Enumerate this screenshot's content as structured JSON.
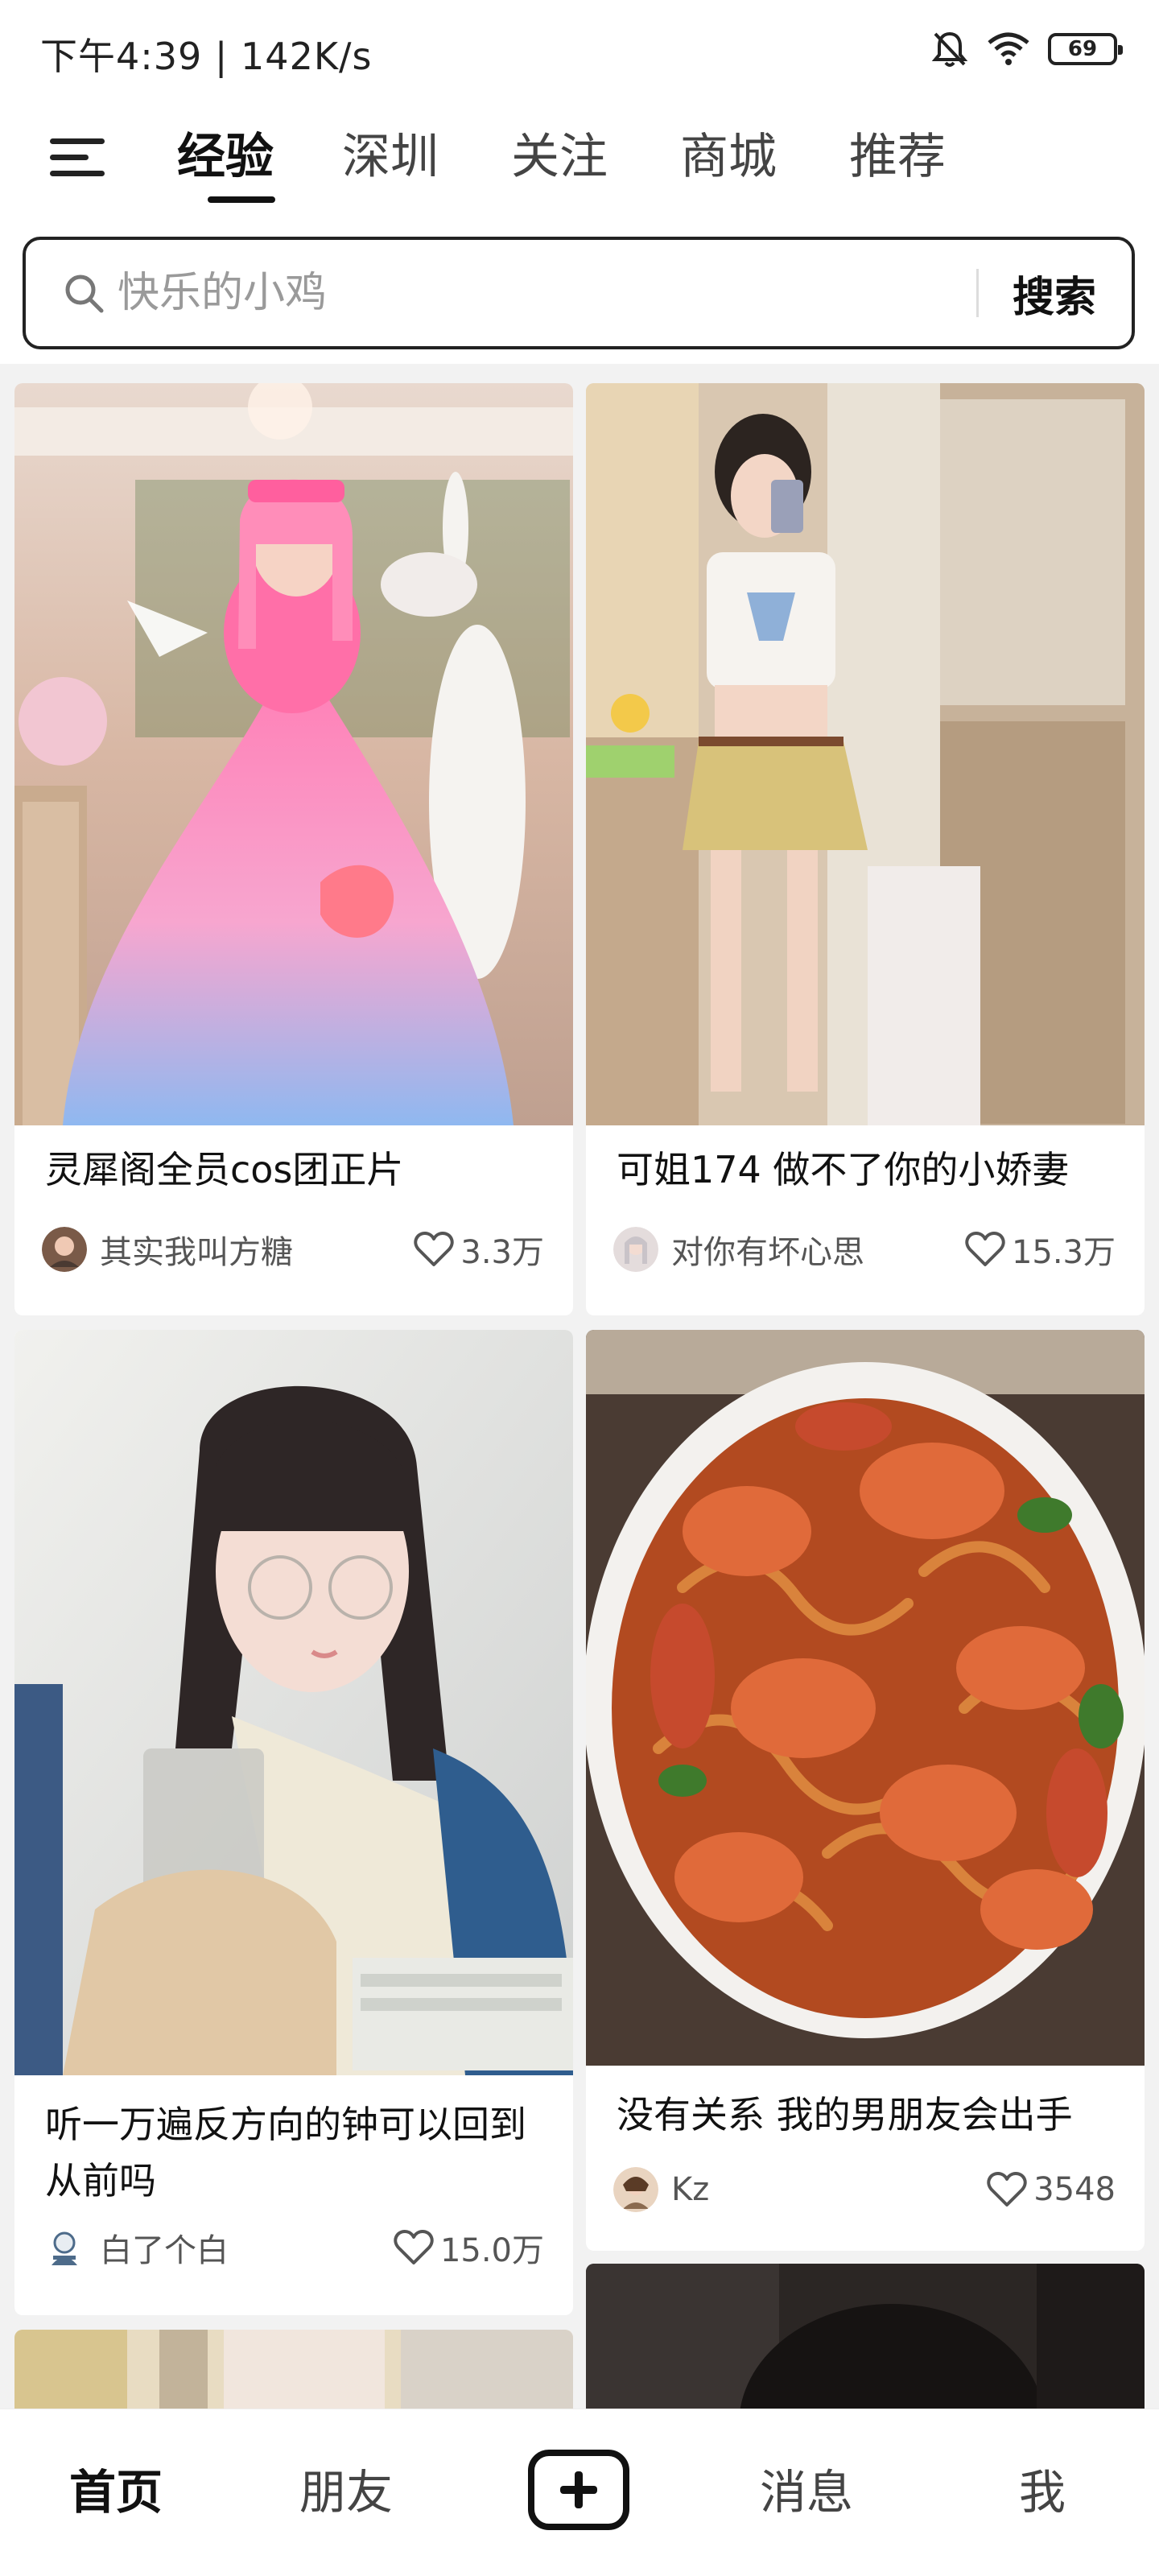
{
  "status_bar": {
    "time_speed": "下午4:39 | 142K/s",
    "battery": "69",
    "icons": [
      "bell-off-icon",
      "wifi-icon",
      "battery-icon"
    ]
  },
  "top_nav": {
    "menu_icon": "menu-icon",
    "tabs": [
      {
        "label": "经验",
        "active": true
      },
      {
        "label": "深圳",
        "active": false
      },
      {
        "label": "关注",
        "active": false
      },
      {
        "label": "商城",
        "active": false
      },
      {
        "label": "推荐",
        "active": false
      }
    ]
  },
  "search": {
    "placeholder": "快乐的小鸡",
    "button_label": "搜索"
  },
  "feed": {
    "cards": [
      {
        "title": "灵犀阁全员cos团正片",
        "author": "其实我叫方糖",
        "likes": "3.3万"
      },
      {
        "title": "可姐174 做不了你的小娇妻",
        "author": "对你有坏心思",
        "likes": "15.3万"
      },
      {
        "title": "听一万遍反方向的钟可以回到从前吗",
        "author": "白了个白",
        "likes": "15.0万"
      },
      {
        "title": "没有关系 我的男朋友会出手",
        "author": "Kz",
        "likes": "3548"
      }
    ]
  },
  "bottom_nav": {
    "home": "首页",
    "friends": "朋友",
    "add_icon": "plus-icon",
    "messages": "消息",
    "me": "我"
  }
}
